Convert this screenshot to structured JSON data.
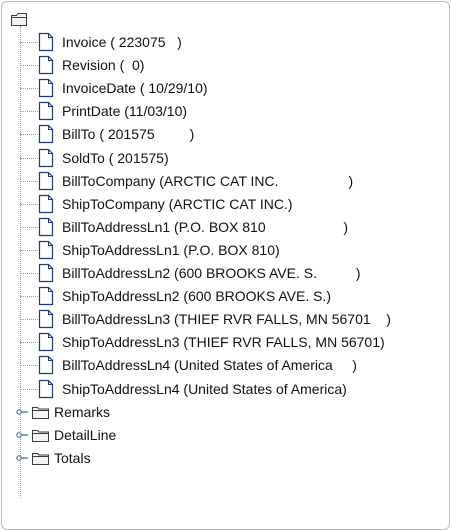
{
  "tree": {
    "root_icon": "folder-open-icon",
    "leaf_icon": "document-icon",
    "branch_icon": "folder-icon",
    "expander_icon": "expand-handle-icon",
    "leaves": [
      "Invoice ( 223075   )",
      "Revision (  0)",
      "InvoiceDate ( 10/29/10)",
      "PrintDate (11/03/10)",
      "BillTo ( 201575         )",
      "SoldTo ( 201575)",
      "BillToCompany (ARCTIC CAT INC.                  )",
      "ShipToCompany (ARCTIC CAT INC.)",
      "BillToAddressLn1 (P.O. BOX 810                    )",
      "ShipToAddressLn1 (P.O. BOX 810)",
      "BillToAddressLn2 (600 BROOKS AVE. S.          )",
      "ShipToAddressLn2 (600 BROOKS AVE. S.)",
      "BillToAddressLn3 (THIEF RVR FALLS, MN 56701    )",
      "ShipToAddressLn3 (THIEF RVR FALLS, MN 56701)",
      "BillToAddressLn4 (United States of America     )",
      "ShipToAddressLn4 (United States of America)"
    ],
    "folders": [
      "Remarks",
      "DetailLine",
      "Totals"
    ]
  },
  "colors": {
    "border": "#b8b8b8",
    "tree_line": "#9a9a9a",
    "doc_fill": "#ffffff",
    "doc_stroke": "#1f3a7a",
    "folder_stroke": "#3c3c3c",
    "folder_fill": "#f4f4f4"
  }
}
